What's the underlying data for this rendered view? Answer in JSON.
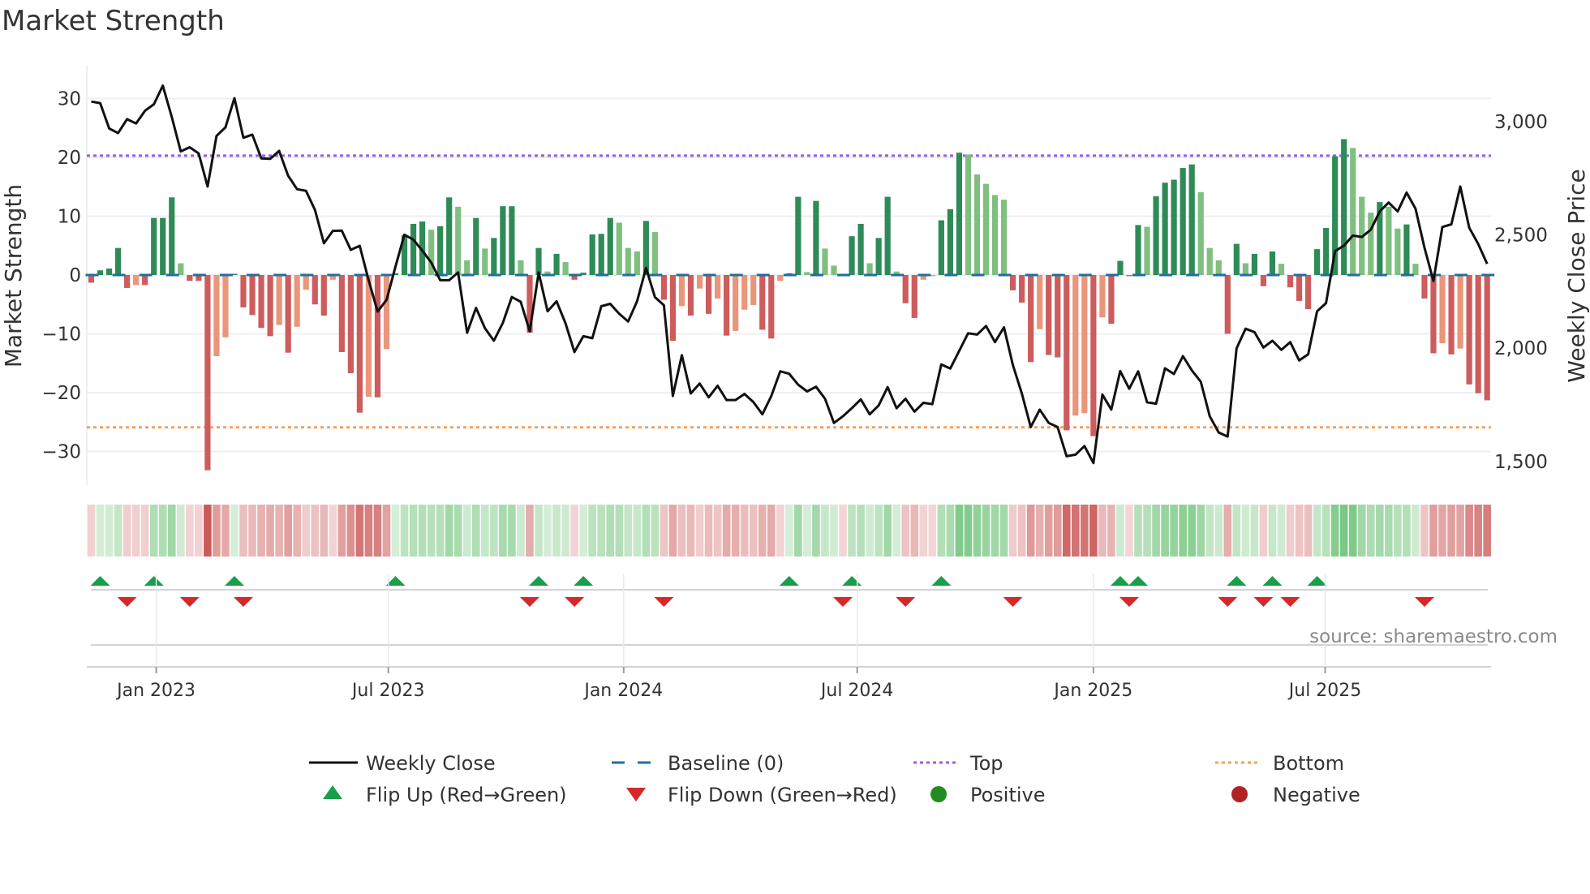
{
  "chart_data": {
    "type": "bar",
    "title": "Market Strength",
    "ylabel": "Market Strength",
    "y2label": "Weekly Close Price",
    "ylim": [
      -35,
      35
    ],
    "y2lim": [
      1410,
      3195
    ],
    "yticks": [
      30,
      20,
      10,
      0,
      -10,
      -20,
      -30
    ],
    "yticklabels": [
      "30",
      "20",
      "10",
      "0",
      "−10",
      "−20",
      "−30"
    ],
    "y2ticks": [
      3000,
      2500,
      2000,
      1500
    ],
    "y2ticklabels": [
      "3,000",
      "2,500",
      "2,000",
      "1,500"
    ],
    "x_unit": "week index",
    "xticks": [
      7.26,
      33.2,
      59.5,
      85.6,
      112.0,
      137.9
    ],
    "xticklabels": [
      "Jan 2023",
      "Jul 2023",
      "Jan 2024",
      "Jul 2024",
      "Jan 2025",
      "Jul 2025"
    ],
    "top_level": 20.3,
    "bottom_level": -25.9,
    "baseline": 0,
    "strength": [
      -1.3,
      0.8,
      1.1,
      4.6,
      -2.2,
      -1.7,
      -1.7,
      9.7,
      9.7,
      13.2,
      2.0,
      -1.0,
      -1.0,
      -33.2,
      -13.8,
      -10.6,
      0.2,
      -5.5,
      -6.8,
      -9.0,
      -10.4,
      -8.5,
      -13.2,
      -8.8,
      -2.5,
      -5.0,
      -6.9,
      -0.8,
      -13.1,
      -16.7,
      -23.4,
      -20.7,
      -20.8,
      -12.6,
      0.3,
      6.8,
      8.7,
      9.1,
      7.7,
      8.3,
      13.2,
      11.6,
      2.5,
      9.7,
      4.5,
      6.3,
      11.7,
      11.7,
      2.5,
      -9.8,
      4.6,
      0.6,
      3.6,
      2.2,
      -0.8,
      0.4,
      6.9,
      7.0,
      9.7,
      8.9,
      4.6,
      4.0,
      9.2,
      7.3,
      -4.2,
      -11.2,
      -5.3,
      -6.9,
      -2.3,
      -6.6,
      -4.0,
      -10.3,
      -9.5,
      -5.9,
      -5.1,
      -9.3,
      -10.8,
      -1.0,
      0.3,
      13.3,
      0.5,
      12.6,
      4.5,
      1.6,
      -0.2,
      6.6,
      8.7,
      2.0,
      6.3,
      13.3,
      0.6,
      -4.8,
      -7.3,
      -0.8,
      -0.2,
      9.3,
      11.2,
      20.8,
      20.5,
      17.1,
      15.5,
      13.6,
      12.8,
      -2.6,
      -4.7,
      -14.8,
      -9.2,
      -13.6,
      -14.0,
      -26.4,
      -23.9,
      -23.5,
      -27.4,
      -7.2,
      -8.3,
      2.4,
      -0.2,
      8.5,
      8.2,
      13.4,
      15.7,
      16.2,
      18.2,
      18.8,
      14.1,
      4.6,
      2.5,
      -10.0,
      5.3,
      2.0,
      3.6,
      -1.9,
      4.0,
      1.9,
      -2.1,
      -4.4,
      -5.8,
      4.4,
      8.0,
      20.2,
      23.1,
      21.6,
      13.3,
      10.6,
      12.4,
      11.6,
      7.9,
      8.6,
      1.9,
      -4.0,
      -13.3,
      -11.6,
      -13.5,
      -12.5,
      -18.6,
      -20.1,
      -21.3
    ],
    "weekly_close": [
      3089,
      3082,
      2970,
      2950,
      3011,
      2992,
      3048,
      3077,
      3159,
      3020,
      2869,
      2887,
      2860,
      2714,
      2937,
      2975,
      3104,
      2929,
      2943,
      2838,
      2836,
      2871,
      2761,
      2702,
      2695,
      2610,
      2463,
      2518,
      2519,
      2434,
      2452,
      2300,
      2162,
      2213,
      2360,
      2501,
      2479,
      2431,
      2378,
      2300,
      2300,
      2334,
      2068,
      2178,
      2088,
      2033,
      2112,
      2226,
      2205,
      2074,
      2334,
      2163,
      2207,
      2110,
      1983,
      2053,
      2044,
      2185,
      2196,
      2152,
      2118,
      2207,
      2354,
      2225,
      2190,
      1789,
      1969,
      1800,
      1844,
      1783,
      1834,
      1771,
      1771,
      1798,
      1762,
      1708,
      1789,
      1898,
      1887,
      1839,
      1809,
      1830,
      1777,
      1670,
      1699,
      1735,
      1774,
      1708,
      1747,
      1828,
      1735,
      1777,
      1720,
      1759,
      1753,
      1928,
      1910,
      1988,
      2066,
      2060,
      2098,
      2027,
      2092,
      1925,
      1800,
      1652,
      1729,
      1670,
      1652,
      1523,
      1530,
      1568,
      1493,
      1795,
      1729,
      1899,
      1821,
      1898,
      1761,
      1755,
      1911,
      1886,
      1965,
      1902,
      1852,
      1699,
      1628,
      1610,
      1999,
      2086,
      2071,
      2003,
      2033,
      1993,
      2027,
      1946,
      1973,
      2163,
      2199,
      2428,
      2453,
      2497,
      2491,
      2523,
      2604,
      2643,
      2604,
      2687,
      2616,
      2443,
      2297,
      2535,
      2547,
      2714,
      2532,
      2461,
      2372
    ],
    "flip_up": [
      1,
      7,
      16,
      34,
      50,
      55,
      78,
      85,
      95,
      115,
      117,
      128,
      132,
      137
    ],
    "flip_down": [
      4,
      11,
      17,
      49,
      54,
      64,
      84,
      91,
      103,
      116,
      127,
      131,
      134,
      149
    ],
    "legend": {
      "weekly_close": "Weekly Close",
      "baseline": "Baseline (0)",
      "top": "Top",
      "bottom": "Bottom",
      "flip_up": "Flip Up (Red→Green)",
      "flip_down": "Flip Down (Green→Red)",
      "positive": "Positive",
      "negative": "Negative"
    },
    "legend_placement": "bottom",
    "grid": true,
    "source": "source: sharemaestro.com",
    "colors": {
      "pos_strong": "#2e8b57",
      "pos_weak": "#7fbf7f",
      "neg_strong": "#cd5c5c",
      "neg_weak": "#e9967a",
      "line": "#111111",
      "baseline": "#1f6f9f",
      "top": "#9b5de5",
      "bottom": "#f4a261",
      "flip_up": "#1a9e4a",
      "flip_down": "#d62828",
      "positive": "#228b22",
      "negative": "#b22222"
    }
  }
}
